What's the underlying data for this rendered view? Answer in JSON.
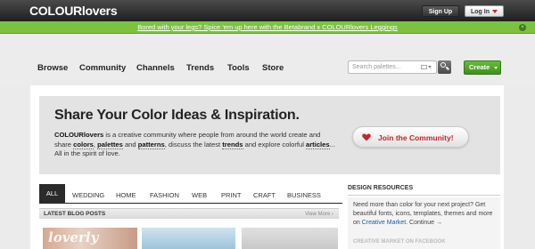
{
  "header": {
    "logo": "COLOURlovers",
    "signup_label": "Sign Up",
    "login_label": "Log In"
  },
  "promo": {
    "text": "Bored with your legs? Spice 'em up here with the Betabrand x COLOURlovers Leggings",
    "close_icon": "close-icon"
  },
  "nav": {
    "items": [
      "Browse",
      "Community",
      "Channels",
      "Trends",
      "Tools",
      "Store"
    ],
    "search_placeholder": "Search palettes...",
    "create_label": "Create"
  },
  "hero": {
    "title": "Share Your Color Ideas & Inspiration.",
    "brand": "COLOURlovers",
    "text_1": " is a creative community where people from around the world create and share ",
    "colors": "colors",
    "sep_1": ", ",
    "palettes": "palettes",
    "and_1": " and ",
    "patterns": "patterns",
    "text_2": ", discuss the latest ",
    "trends": "trends",
    "text_3": " and explore colorful ",
    "articles": "articles",
    "text_4": "... All in the spirit of love.",
    "join_label": "Join the Community!"
  },
  "tabs": {
    "items": [
      "ALL",
      "WEDDING",
      "HOME",
      "FASHION",
      "WEB",
      "PRINT",
      "CRAFT",
      "BUSINESS"
    ]
  },
  "blog": {
    "header": "LATEST BLOG POSTS",
    "view_more": "View More ›",
    "thumb_1_text": "loverly"
  },
  "sidebar": {
    "title": "DESIGN RESOURCES",
    "text": "Need more than color for your next project? Get beautiful fonts, icons, templates, themes and more on ",
    "link": "Creative Market",
    "cta": ". Continue →",
    "sub": "CREATIVE MARKET ON FACEBOOK"
  },
  "colors": {
    "promo_green": "#7dc142",
    "create_green": "#4fa428",
    "join_red": "#c0282d",
    "link_blue": "#1a5fa8"
  }
}
